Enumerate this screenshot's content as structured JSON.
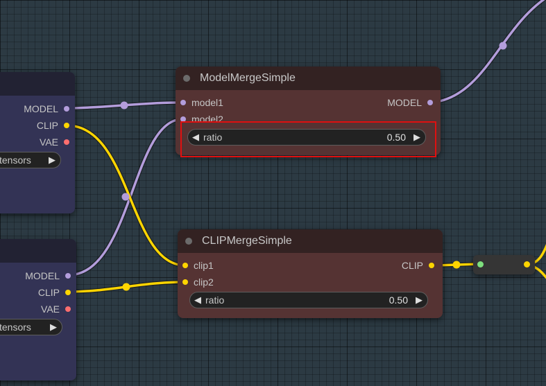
{
  "colors": {
    "model_link": "#b39ddb",
    "clip_link": "#ffd500",
    "vae_link": "#ff6e6e",
    "node_brown": "#553333",
    "node_blue": "#333355",
    "highlight": "#e01010"
  },
  "nodes": {
    "model_merge": {
      "title": "ModelMergeSimple",
      "inputs": [
        "model1",
        "model2"
      ],
      "output": "MODEL",
      "widget": {
        "label": "ratio",
        "value": "0.50"
      }
    },
    "clip_merge": {
      "title": "CLIPMergeSimple",
      "inputs": [
        "clip1",
        "clip2"
      ],
      "output": "CLIP",
      "widget": {
        "label": "ratio",
        "value": "0.50"
      }
    },
    "checkpoint_top": {
      "outputs": [
        "MODEL",
        "CLIP",
        "VAE"
      ],
      "widget_label": "tensors"
    },
    "checkpoint_bottom": {
      "outputs": [
        "MODEL",
        "CLIP",
        "VAE"
      ],
      "widget_label": "tensors"
    }
  },
  "icons": {
    "arrow_left": "◀",
    "arrow_right": "▶"
  }
}
